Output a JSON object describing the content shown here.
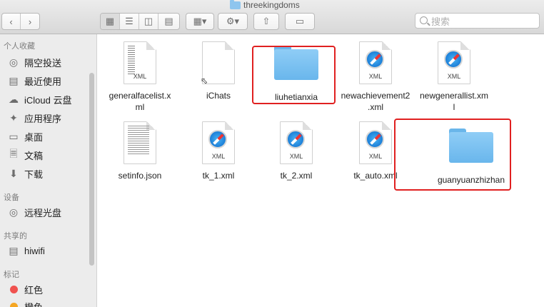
{
  "window": {
    "title": "threekingdoms"
  },
  "toolbar": {
    "back_icon": "chevron-left-icon",
    "forward_icon": "chevron-right-icon",
    "arrange_icon": "grid-dropdown-icon",
    "action_icon": "gear-icon",
    "share_icon": "share-icon",
    "tag_icon": "tag-icon",
    "search_placeholder": "搜索"
  },
  "sidebar": {
    "favorites_header": "个人收藏",
    "favorites": [
      {
        "label": "隔空投送",
        "icon": "airdrop-icon"
      },
      {
        "label": "最近使用",
        "icon": "recents-icon"
      },
      {
        "label": "iCloud 云盘",
        "icon": "cloud-icon"
      },
      {
        "label": "应用程序",
        "icon": "applications-icon"
      },
      {
        "label": "桌面",
        "icon": "desktop-icon"
      },
      {
        "label": "文稿",
        "icon": "documents-icon"
      },
      {
        "label": "下载",
        "icon": "downloads-icon"
      }
    ],
    "devices_header": "设备",
    "devices": [
      {
        "label": "远程光盘",
        "icon": "disc-icon"
      }
    ],
    "shared_header": "共享的",
    "shared": [
      {
        "label": "hiwifi",
        "icon": "computer-icon"
      }
    ],
    "tags_header": "标记",
    "tags": [
      {
        "label": "红色",
        "color": "#f0524f"
      },
      {
        "label": "橙色",
        "color": "#f5a623"
      }
    ]
  },
  "files": [
    {
      "name": "generalfacelist.xml",
      "line1": "generalfacelist.x",
      "line2": "ml",
      "kind": "xml"
    },
    {
      "name": "iChats",
      "line1": "iChats",
      "line2": "",
      "kind": "alias"
    },
    {
      "name": "liuhetianxia",
      "line1": "liuhetianxia",
      "line2": "",
      "kind": "folder",
      "highlighted": true
    },
    {
      "name": "newachievement2.xml",
      "line1": "newachievement2",
      "line2": ".xml",
      "kind": "safari"
    },
    {
      "name": "newgenerallist.xml",
      "line1": "newgenerallist.xm",
      "line2": "l",
      "kind": "safari"
    },
    {
      "name": "setinfo.json",
      "line1": "setinfo.json",
      "line2": "",
      "kind": "text"
    },
    {
      "name": "tk_1.xml",
      "line1": "tk_1.xml",
      "line2": "",
      "kind": "safari"
    },
    {
      "name": "tk_2.xml",
      "line1": "tk_2.xml",
      "line2": "",
      "kind": "safari"
    },
    {
      "name": "tk_auto.xml",
      "line1": "tk_auto.xml",
      "line2": "",
      "kind": "safari"
    },
    {
      "name": "guanyuanzhizhan",
      "line1": "guanyuanzhizhan",
      "line2": "",
      "kind": "folder",
      "highlighted": true
    }
  ],
  "icon_ext": "XML",
  "accent_colors": {
    "folder": "#7cc2f2",
    "highlight": "#e02020"
  }
}
